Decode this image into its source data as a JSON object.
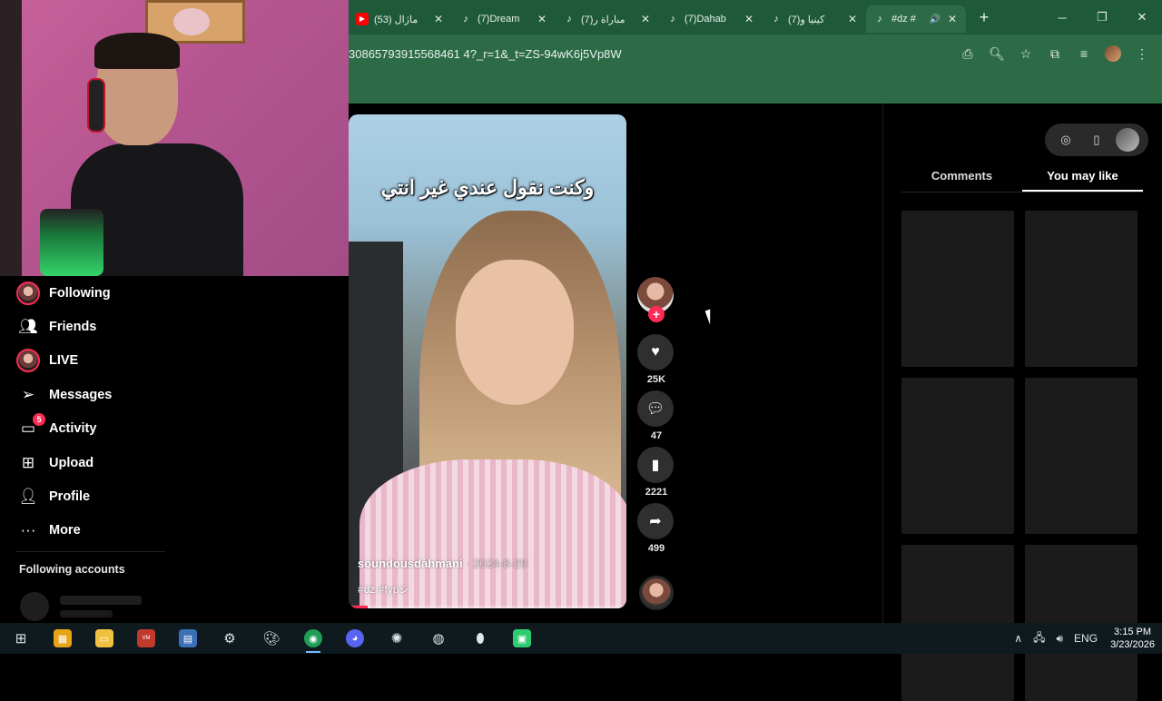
{
  "browser": {
    "tabs": [
      {
        "label": "(53) ماژال",
        "icon": "youtube-icon"
      },
      {
        "label": "(7)Dream",
        "icon": "tiktok-icon"
      },
      {
        "label": "(7)مباراة ر",
        "icon": "tiktok-icon"
      },
      {
        "label": "(7)Dahab",
        "icon": "tiktok-icon"
      },
      {
        "label": "(7)كينيا و",
        "icon": "tiktok-icon"
      },
      {
        "label": "#dz #",
        "icon": "tiktok-icon",
        "active": true
      }
    ],
    "url": "30865793915568461 4?_r=1&_t=ZS-94wK6j5Vp8W",
    "new_tab_label": "+"
  },
  "sidebar": {
    "items": [
      {
        "label": "Following",
        "icon": "following-avatar-icon"
      },
      {
        "label": "Friends",
        "icon": "friends-icon"
      },
      {
        "label": "LIVE",
        "icon": "live-avatar-icon"
      },
      {
        "label": "Messages",
        "icon": "messages-icon"
      },
      {
        "label": "Activity",
        "icon": "activity-icon",
        "badge": "5"
      },
      {
        "label": "Upload",
        "icon": "upload-icon"
      },
      {
        "label": "Profile",
        "icon": "profile-icon"
      },
      {
        "label": "More",
        "icon": "more-icon"
      }
    ],
    "following_accounts_title": "Following accounts"
  },
  "video": {
    "caption_overlay": "وكنت نقول عندي غير انتي",
    "author": "soundousdahmani",
    "date": " · 2024-8-29",
    "tags": "#dz #fypシ",
    "progress": 0.07
  },
  "actions": {
    "likes": "25K",
    "comments": "47",
    "saves": "2221",
    "shares": "499"
  },
  "right_panel": {
    "tabs": [
      {
        "label": "Comments",
        "active": false
      },
      {
        "label": "You may like",
        "active": true
      }
    ]
  },
  "taskbar": {
    "language": "ENG",
    "time": "3:15 PM",
    "date": "3/23/2026"
  },
  "colors": {
    "accent": "#fe2c55",
    "browser_frame": "#1e5a3a",
    "browser_toolbar": "#2d6b47"
  }
}
